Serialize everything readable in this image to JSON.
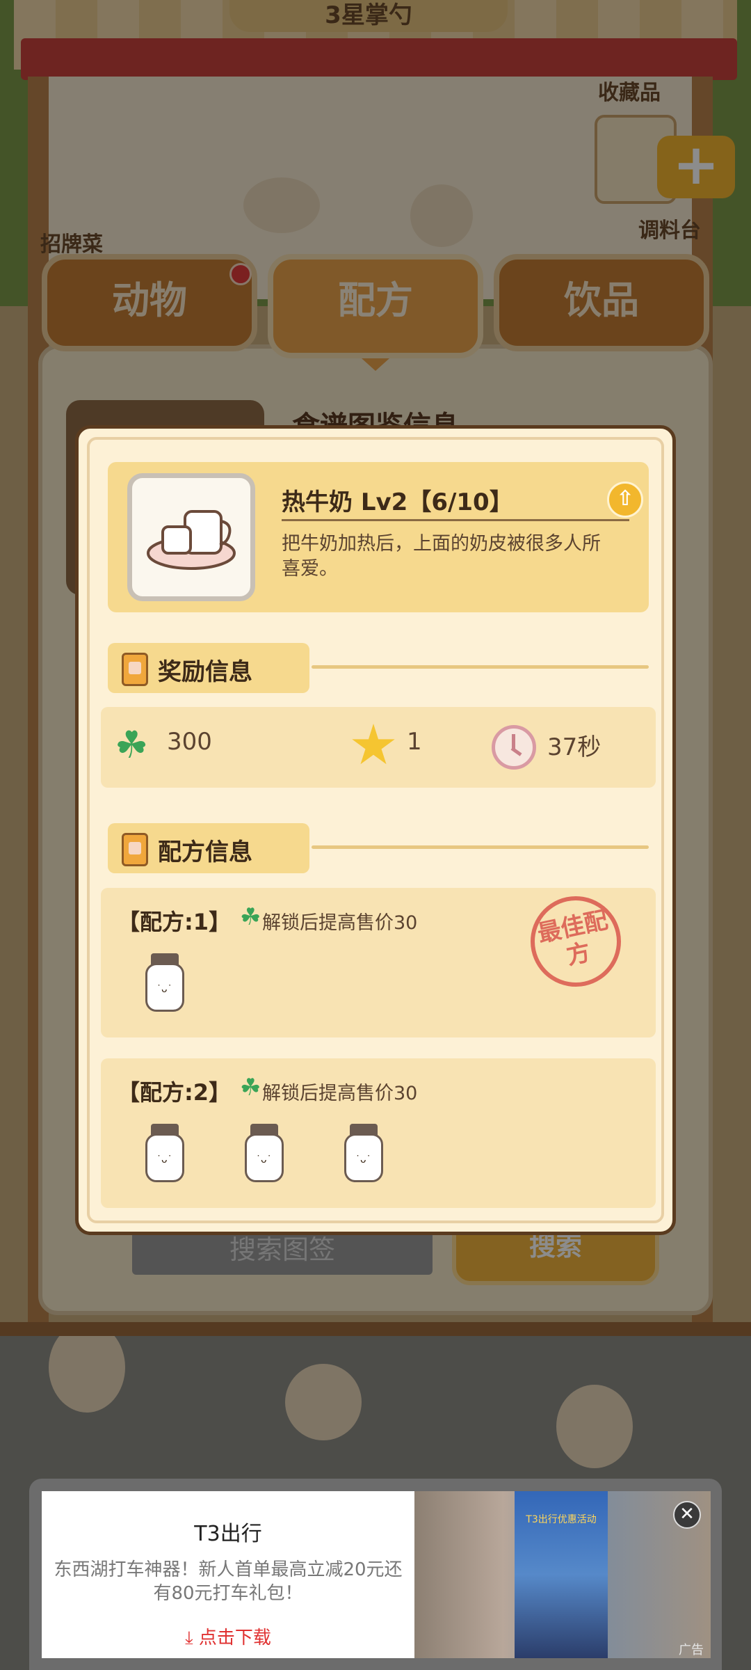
{
  "scene": {
    "roof_title": "3星掌勺",
    "collection_label": "收藏品",
    "signature_label": "招牌菜",
    "seasoning_label": "调料台"
  },
  "tabs": [
    {
      "label": "动物",
      "active": false,
      "has_badge": true
    },
    {
      "label": "配方",
      "active": true,
      "has_badge": false
    },
    {
      "label": "饮品",
      "active": false,
      "has_badge": false
    }
  ],
  "panel": {
    "heading": "食谱图鉴信息",
    "search_placeholder": "搜索图签",
    "search_button": "搜索"
  },
  "popup": {
    "item": {
      "name": "热牛奶 Lv2【6/10】",
      "description": "把牛奶加热后，上面的奶皮被很多人所喜爱。",
      "icon": "hot-milk-icon"
    },
    "reward_section_title": "奖励信息",
    "rewards": {
      "clover": "300",
      "star": "1",
      "time": "37秒"
    },
    "recipe_section_title": "配方信息",
    "recipes": [
      {
        "title": "【配方:1】",
        "unlock": "解锁后提高售价30",
        "bottle_count": 1,
        "best": true,
        "stamp": "最佳配方"
      },
      {
        "title": "【配方:2】",
        "unlock": "解锁后提高售价30",
        "bottle_count": 3,
        "best": false
      }
    ]
  },
  "ad": {
    "title": "T3出行",
    "description": "东西湖打车神器！新人首单最高立减20元还有80元打车礼包！",
    "cta": "点击下载",
    "poster_text": "T3出行优惠活动",
    "close": "✕",
    "tag": "广告"
  },
  "colors": {
    "panel_bg": "#f3e5c6",
    "tab_orange": "#c47d34",
    "popup_bg": "#fdf1d6",
    "section_yellow": "#f6d98e",
    "clover_green": "#3aa457",
    "stamp_red": "#d9574c"
  }
}
